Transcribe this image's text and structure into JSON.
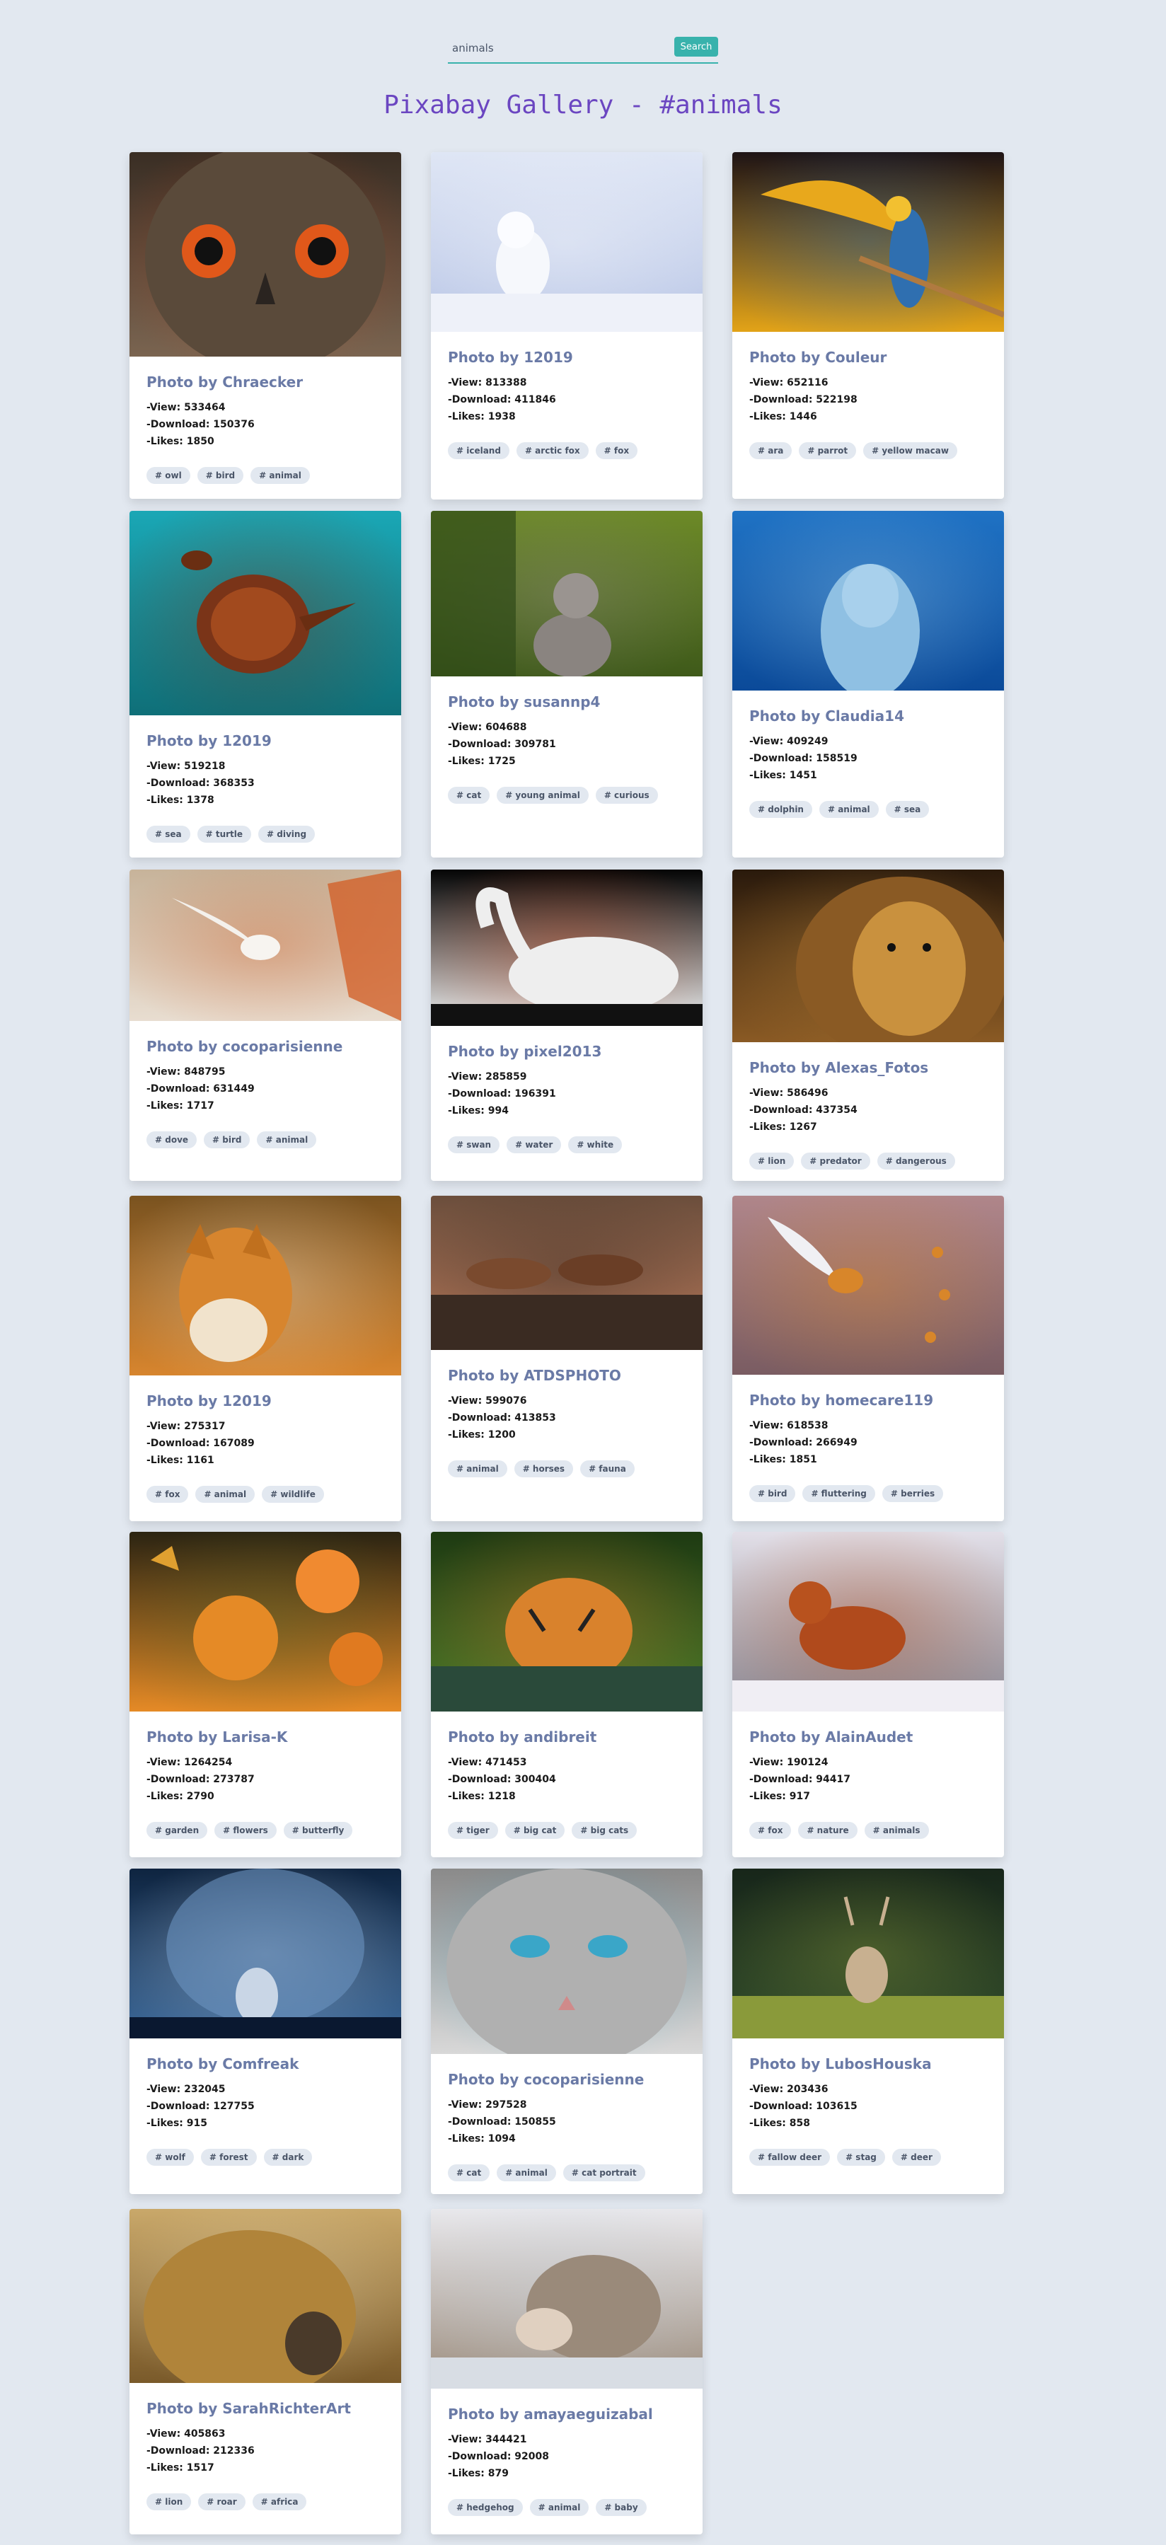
{
  "search": {
    "value": "animals",
    "button_label": "Search"
  },
  "page_title": "Pixabay Gallery - #animals",
  "photos": [
    {
      "author": "Photo by Chraecker",
      "views": "-View: 533464",
      "downloads": "-Download: 150376",
      "likes": "-Likes: 1850",
      "tags": [
        "# owl",
        "# bird",
        "# animal"
      ],
      "image": "owl",
      "colors": [
        "#3a2e24",
        "#7a6450",
        "#c8431a"
      ]
    },
    {
      "author": "Photo by 12019",
      "views": "-View: 813388",
      "downloads": "-Download: 411846",
      "likes": "-Likes: 1938",
      "tags": [
        "# iceland",
        "# arctic fox",
        "# fox"
      ],
      "image": "arctic-fox",
      "colors": [
        "#dfe6f5",
        "#b9c6e6",
        "#f4f6fb"
      ]
    },
    {
      "author": "Photo by Couleur",
      "views": "-View: 652116",
      "downloads": "-Download: 522198",
      "likes": "-Likes: 1446",
      "tags": [
        "# ara",
        "# parrot",
        "# yellow macaw"
      ],
      "image": "macaw",
      "colors": [
        "#1e1416",
        "#e2a318",
        "#2f6fb0"
      ]
    },
    {
      "author": "Photo by 12019",
      "views": "-View: 519218",
      "downloads": "-Download: 368353",
      "likes": "-Likes: 1378",
      "tags": [
        "# sea",
        "# turtle",
        "# diving"
      ],
      "image": "sea-turtle",
      "colors": [
        "#1aa7b5",
        "#0f6f78",
        "#7a3418"
      ]
    },
    {
      "author": "Photo by susannp4",
      "views": "-View: 604688",
      "downloads": "-Download: 309781",
      "likes": "-Likes: 1725",
      "tags": [
        "# cat",
        "# young animal",
        "# curious"
      ],
      "image": "kitten",
      "colors": [
        "#6d8a28",
        "#3f5a1a",
        "#8a8480"
      ]
    },
    {
      "author": "Photo by Claudia14",
      "views": "-View: 409249",
      "downloads": "-Download: 158519",
      "likes": "-Likes: 1451",
      "tags": [
        "# dolphin",
        "# animal",
        "# sea"
      ],
      "image": "dolphin",
      "colors": [
        "#1f72c4",
        "#0b4a99",
        "#8fc0e3"
      ]
    },
    {
      "author": "Photo by cocoparisienne",
      "views": "-View: 848795",
      "downloads": "-Download: 631449",
      "likes": "-Likes: 1717",
      "tags": [
        "# dove",
        "# bird",
        "# animal"
      ],
      "image": "dove",
      "colors": [
        "#c7b39a",
        "#e8ddd0",
        "#d2622b"
      ]
    },
    {
      "author": "Photo by pixel2013",
      "views": "-View: 285859",
      "downloads": "-Download: 196391",
      "likes": "-Likes: 994",
      "tags": [
        "# swan",
        "# water",
        "# white"
      ],
      "image": "swan",
      "colors": [
        "#050505",
        "#eeeeee",
        "#d24a1c"
      ]
    },
    {
      "author": "Photo by Alexas_Fotos",
      "views": "-View: 586496",
      "downloads": "-Download: 437354",
      "likes": "-Likes: 1267",
      "tags": [
        "# lion",
        "# predator",
        "# dangerous"
      ],
      "image": "lion",
      "colors": [
        "#2a1a0c",
        "#8a5a24",
        "#c9913e"
      ]
    },
    {
      "author": "Photo by 12019",
      "views": "-View: 275317",
      "downloads": "-Download: 167089",
      "likes": "-Likes: 1161",
      "tags": [
        "# fox",
        "# animal",
        "# wildlife"
      ],
      "image": "red-fox",
      "colors": [
        "#7a5320",
        "#d7852e",
        "#f1e3cc"
      ]
    },
    {
      "author": "Photo by ATDSPHOTO",
      "views": "-View: 599076",
      "downloads": "-Download: 413853",
      "likes": "-Likes: 1200",
      "tags": [
        "# animal",
        "# horses",
        "# fauna"
      ],
      "image": "horses",
      "colors": [
        "#6b4e3c",
        "#b8795a",
        "#3a2b22"
      ]
    },
    {
      "author": "Photo by homecare119",
      "views": "-View: 618538",
      "downloads": "-Download: 266949",
      "likes": "-Likes: 1851",
      "tags": [
        "# bird",
        "# fluttering",
        "# berries"
      ],
      "image": "bird-berries",
      "colors": [
        "#b0868a",
        "#7a5c62",
        "#d8862a"
      ]
    },
    {
      "author": "Photo by Larisa-K",
      "views": "-View: 1264254",
      "downloads": "-Download: 273787",
      "likes": "-Likes: 2790",
      "tags": [
        "# garden",
        "# flowers",
        "# butterfly"
      ],
      "image": "flowers-butterfly",
      "colors": [
        "#2b2412",
        "#e58a26",
        "#5d6a2a"
      ]
    },
    {
      "author": "Photo by andibreit",
      "views": "-View: 471453",
      "downloads": "-Download: 300404",
      "likes": "-Likes: 1218",
      "tags": [
        "# tiger",
        "# big cat",
        "# big cats"
      ],
      "image": "tiger",
      "colors": [
        "#1e3a12",
        "#4a7a28",
        "#d9822c"
      ]
    },
    {
      "author": "Photo by AlainAudet",
      "views": "-View: 190124",
      "downloads": "-Download: 94417",
      "likes": "-Likes: 917",
      "tags": [
        "# fox",
        "# nature",
        "# animals"
      ],
      "image": "fox-snow",
      "colors": [
        "#e2dfe8",
        "#8a8690",
        "#b04a1c"
      ]
    },
    {
      "author": "Photo by Comfreak",
      "views": "-View: 232045",
      "downloads": "-Download: 127755",
      "likes": "-Likes: 915",
      "tags": [
        "# wolf",
        "# forest",
        "# dark"
      ],
      "image": "wolf",
      "colors": [
        "#0e2440",
        "#3e6a9a",
        "#c9d6e6"
      ]
    },
    {
      "author": "Photo by cocoparisienne",
      "views": "-View: 297528",
      "downloads": "-Download: 150855",
      "likes": "-Likes: 1094",
      "tags": [
        "# cat",
        "# animal",
        "# cat portrait"
      ],
      "image": "cat-portrait",
      "colors": [
        "#8a8a8a",
        "#d8d8d8",
        "#3aa6c8"
      ]
    },
    {
      "author": "Photo by LubosHouska",
      "views": "-View: 203436",
      "downloads": "-Download: 103615",
      "likes": "-Likes: 858",
      "tags": [
        "# fallow deer",
        "# stag",
        "# deer"
      ],
      "image": "deer",
      "colors": [
        "#17261a",
        "#2f4a2a",
        "#8a9a3a"
      ]
    },
    {
      "author": "Photo by SarahRichterArt",
      "views": "-View: 405863",
      "downloads": "-Download: 212336",
      "likes": "-Likes: 1517",
      "tags": [
        "# lion",
        "# roar",
        "# africa"
      ],
      "image": "lion-girl",
      "colors": [
        "#c9a86a",
        "#7a5a2a",
        "#e8d8b0"
      ]
    },
    {
      "author": "Photo by amayaeguizabal",
      "views": "-View: 344421",
      "downloads": "-Download: 92008",
      "likes": "-Likes: 879",
      "tags": [
        "# hedgehog",
        "# animal",
        "# baby"
      ],
      "image": "hedgehog",
      "colors": [
        "#e8e8ec",
        "#9a8a7a",
        "#c8d0d8"
      ]
    }
  ]
}
